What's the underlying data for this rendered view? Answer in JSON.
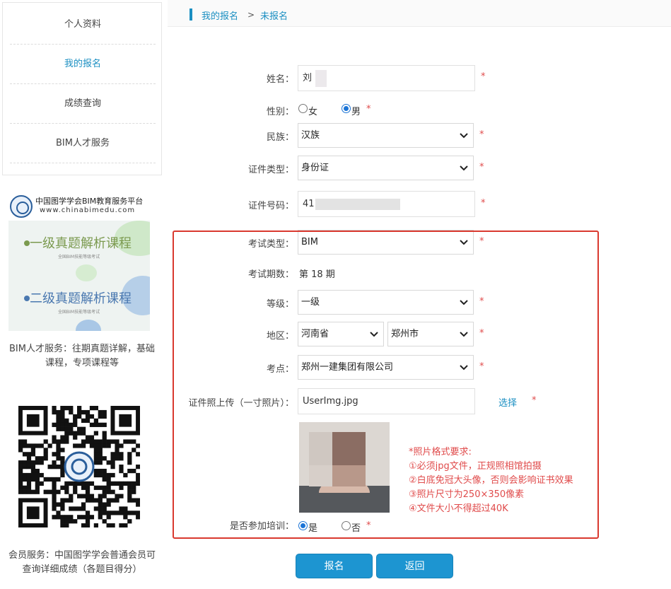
{
  "sidebar": {
    "menu": [
      {
        "label": "个人资料",
        "active": false
      },
      {
        "label": "我的报名",
        "active": true
      },
      {
        "label": "成绩查询",
        "active": false
      },
      {
        "label": "BIM人才服务",
        "active": false
      }
    ],
    "promo": {
      "org": "中国图学学会BIM教育服务平台",
      "url": "www.chinabimedu.com",
      "course1": "一级真题解析课程",
      "course2": "二级真题解析课程",
      "course_sub": "全国BIM技能等级考试"
    },
    "promo_text": "BIM人才服务：往期真题详解，基础课程，专项课程等",
    "member_text": "会员服务：中国图学学会普通会员可查询详细成绩（各题目得分）"
  },
  "breadcrumb": {
    "level1": "我的报名",
    "separator": ">",
    "level2": "未报名"
  },
  "form": {
    "name": {
      "label": "姓名：",
      "value": "刘"
    },
    "gender": {
      "label": "性别：",
      "options": [
        "女",
        "男"
      ],
      "selected": "男"
    },
    "ethnicity": {
      "label": "民族：",
      "value": "汉族"
    },
    "id_type": {
      "label": "证件类型：",
      "value": "身份证"
    },
    "id_number": {
      "label": "证件号码：",
      "value": "411"
    },
    "exam_type": {
      "label": "考试类型：",
      "value": "BIM"
    },
    "exam_period": {
      "label": "考试期数：",
      "value": "第 18 期"
    },
    "level": {
      "label": "等级：",
      "value": "一级"
    },
    "region": {
      "label": "地区：",
      "province": "河南省",
      "city": "郑州市"
    },
    "exam_site": {
      "label": "考点：",
      "value": "郑州一建集团有限公司"
    },
    "photo_upload": {
      "label": "证件照上传（一寸照片）：",
      "filename": "UserImg.jpg",
      "choose_label": "选择"
    },
    "photo_requirements": [
      "*照片格式要求:",
      "①必须jpg文件，正规照相馆拍摄",
      "②白底免冠大头像，否则会影响证书效果",
      "③照片尺寸为250×350像素",
      "④文件大小不得超过40K"
    ],
    "training": {
      "label": "是否参加培训：",
      "options": [
        "是",
        "否"
      ],
      "selected": "是"
    },
    "required_mark": "*"
  },
  "buttons": {
    "submit": "报名",
    "back": "返回"
  },
  "colors": {
    "accent": "#1b8fc2",
    "button": "#1d95d1",
    "required": "#e04b4b",
    "highlight_border": "#d9392f"
  }
}
